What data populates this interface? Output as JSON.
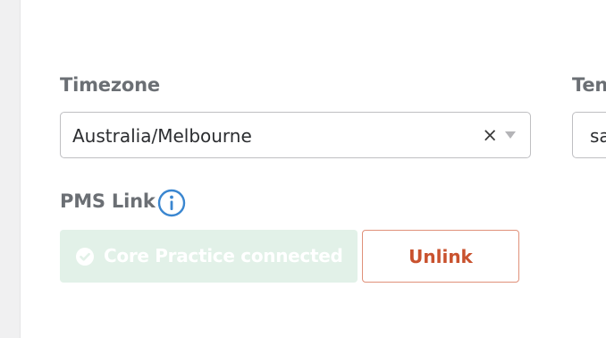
{
  "timezone": {
    "label": "Timezone",
    "value": "Australia/Melbourne",
    "clear_glyph": "×"
  },
  "tenant": {
    "label": "Ten",
    "value": "sa"
  },
  "pms_link": {
    "label": "PMS Link",
    "status_text": "Core Practice connected",
    "unlink_label": "Unlink"
  },
  "icons": {
    "info": "info-circle-icon",
    "check": "check-circle-icon",
    "clear": "close-icon",
    "dropdown": "caret-down-icon"
  },
  "colors": {
    "label": "#6b6f74",
    "info_blue": "#3a86d0",
    "connected_bg": "#e2f1e8",
    "unlink_text": "#c9522e",
    "unlink_border": "#e0917a"
  }
}
